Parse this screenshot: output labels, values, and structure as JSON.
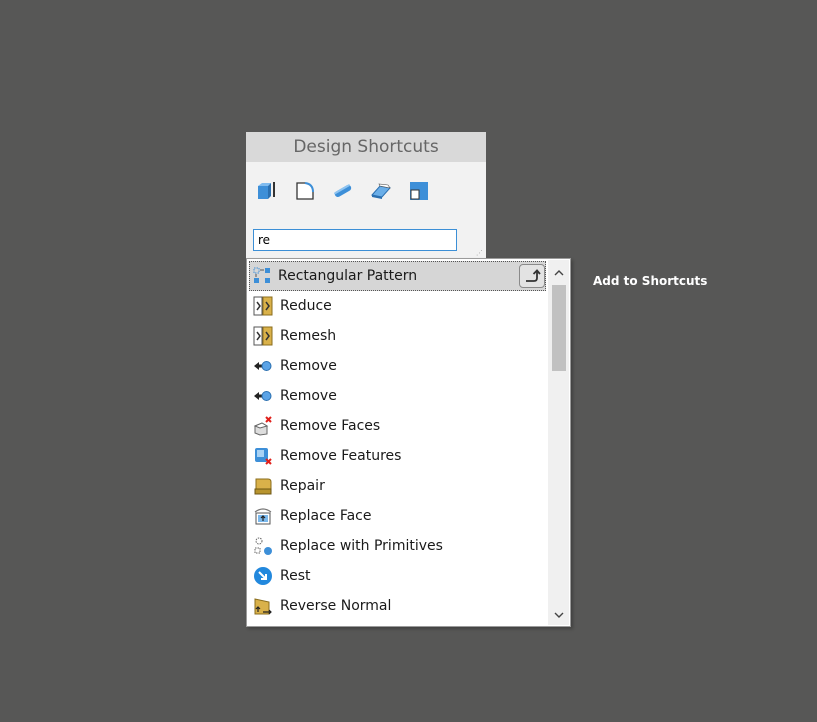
{
  "panel": {
    "title": "Design Shortcuts"
  },
  "toolbar": {
    "icons": [
      "pull-icon",
      "fillet-icon",
      "extrude-icon",
      "sketch-icon",
      "move-icon"
    ]
  },
  "search": {
    "value": "re"
  },
  "results": [
    {
      "label": "Rectangular Pattern",
      "icon": "rectangular-pattern-icon"
    },
    {
      "label": "Reduce",
      "icon": "reduce-icon"
    },
    {
      "label": "Remesh",
      "icon": "remesh-icon"
    },
    {
      "label": "Remove",
      "icon": "remove-icon"
    },
    {
      "label": "Remove",
      "icon": "remove-icon"
    },
    {
      "label": "Remove Faces",
      "icon": "remove-faces-icon"
    },
    {
      "label": "Remove Features",
      "icon": "remove-features-icon"
    },
    {
      "label": "Repair",
      "icon": "repair-icon"
    },
    {
      "label": "Replace Face",
      "icon": "replace-face-icon"
    },
    {
      "label": "Replace with Primitives",
      "icon": "replace-with-primitives-icon"
    },
    {
      "label": "Rest",
      "icon": "rest-icon"
    },
    {
      "label": "Reverse Normal",
      "icon": "reverse-normal-icon"
    }
  ],
  "tooltip": {
    "text": "Add to Shortcuts"
  },
  "colors": {
    "background": "#575756",
    "accent": "#3c8fd6",
    "selected": "#d6d6d6"
  }
}
